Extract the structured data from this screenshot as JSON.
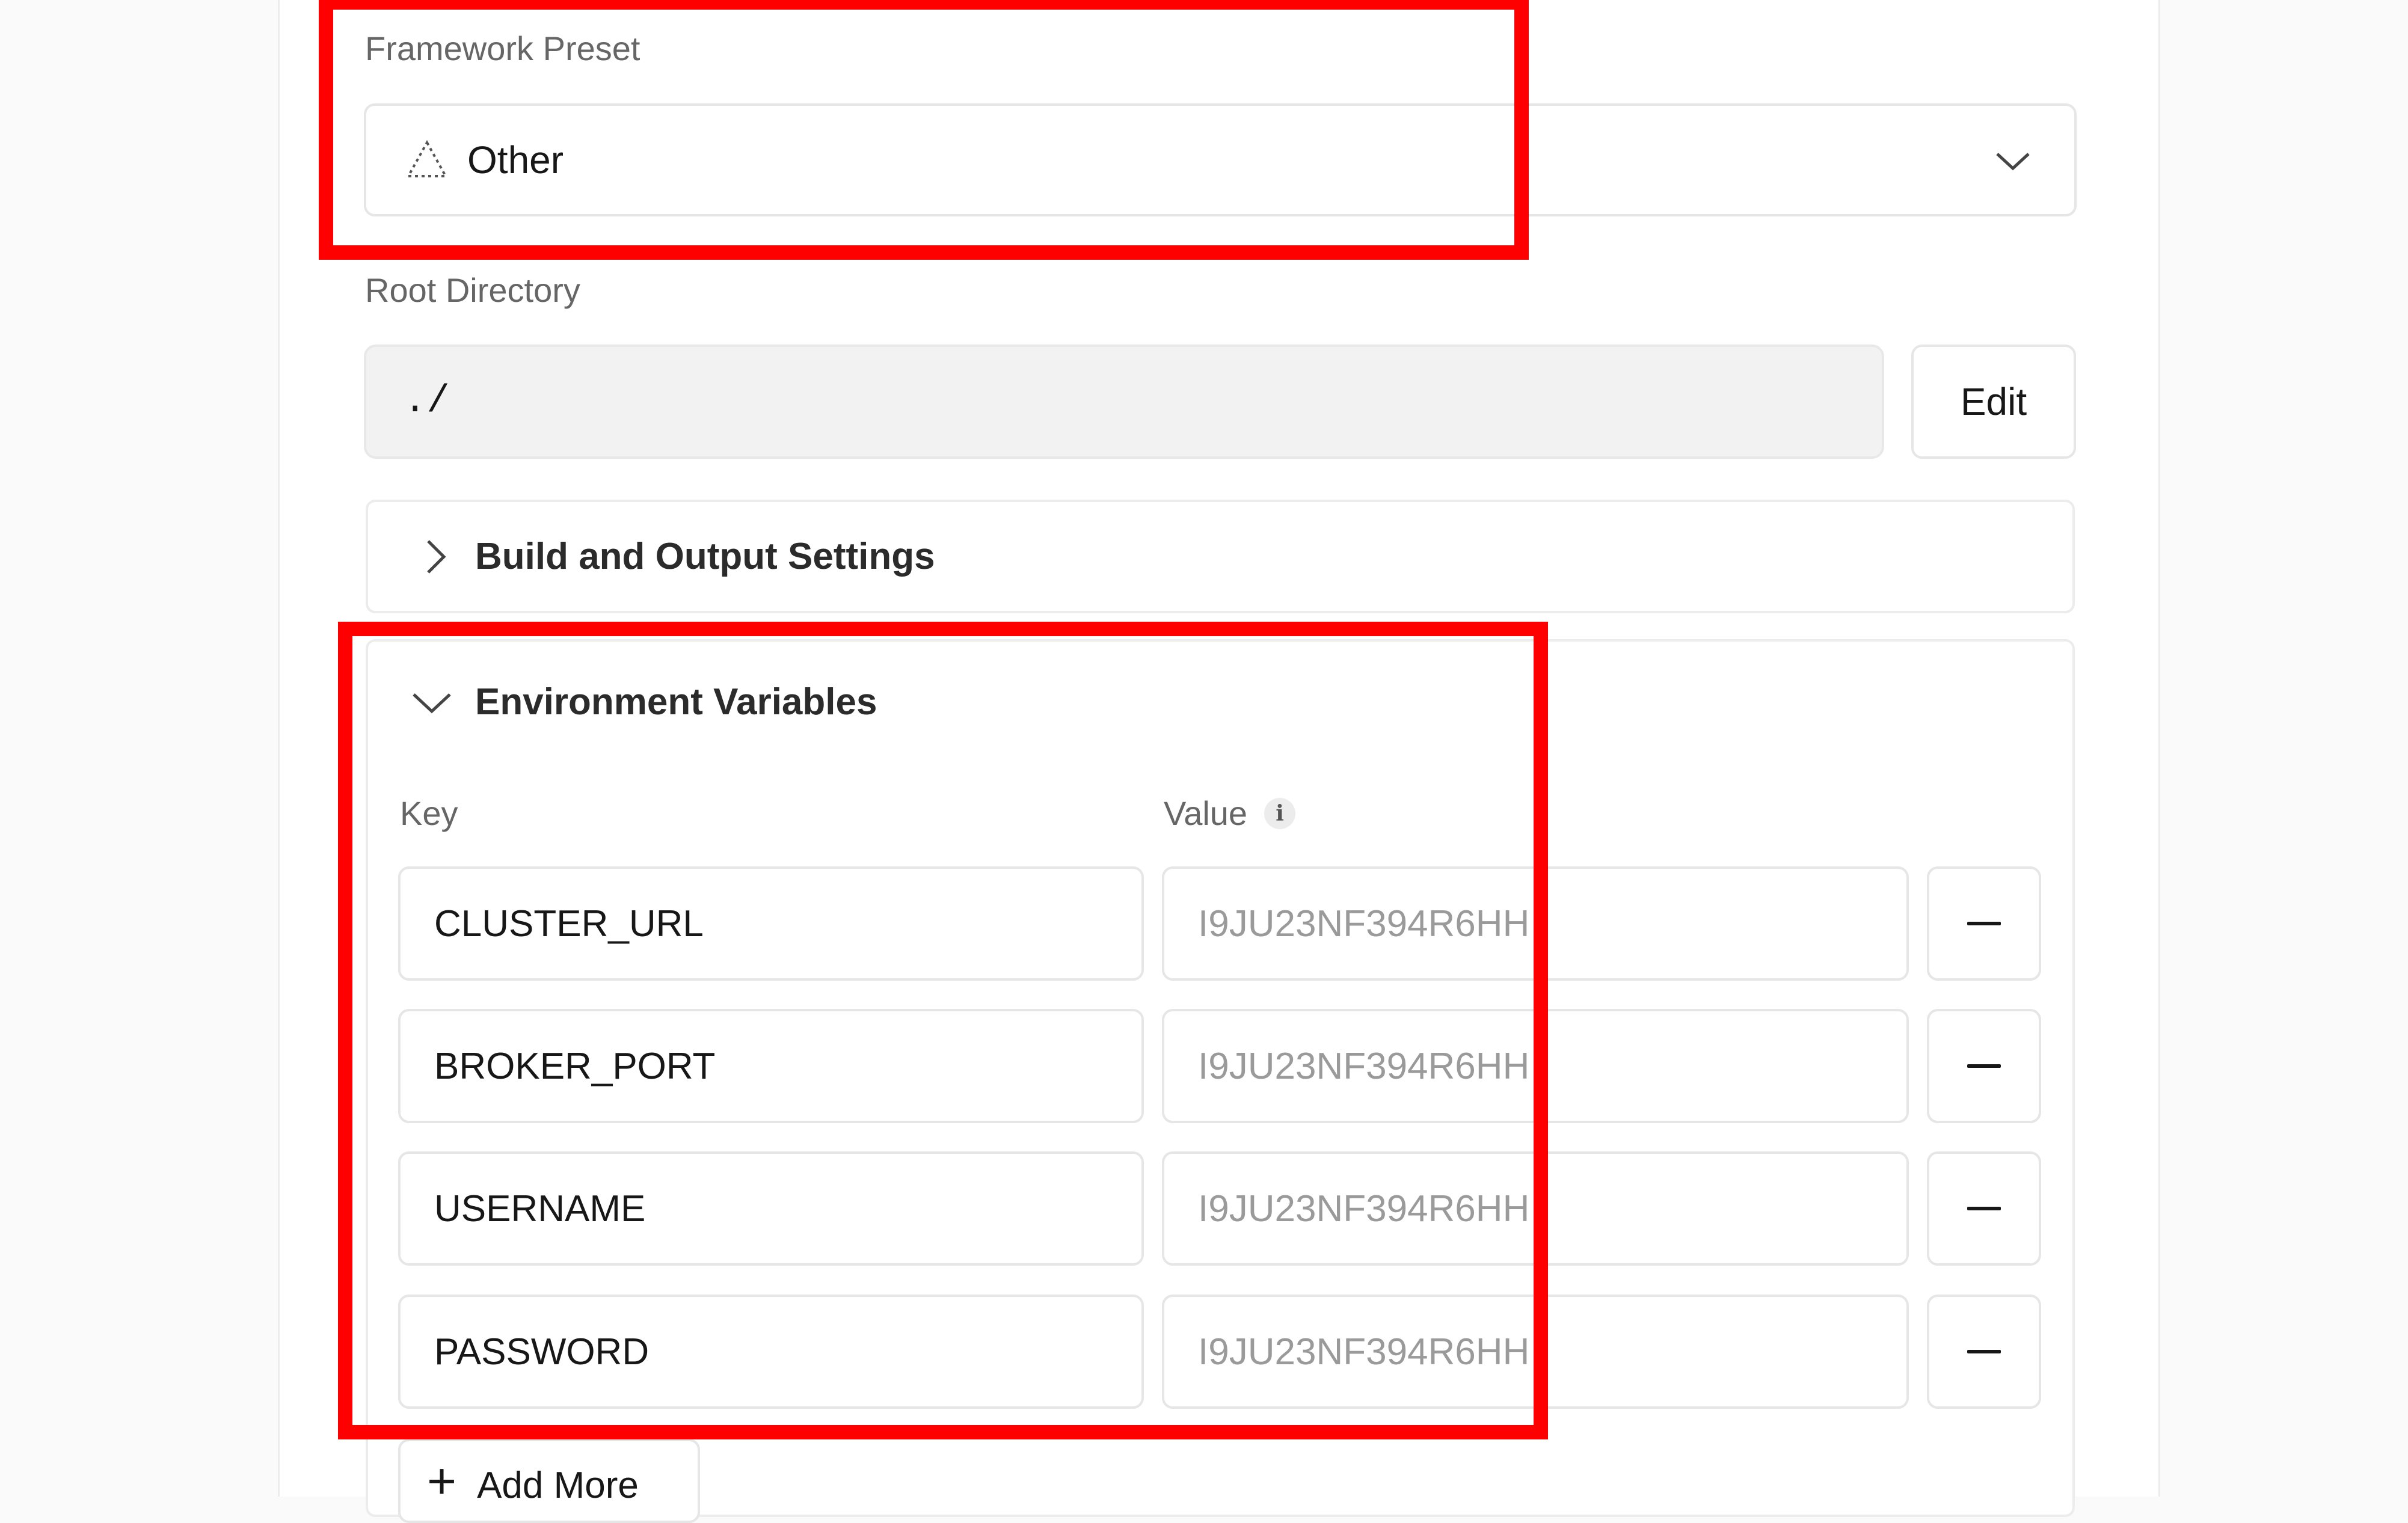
{
  "framework": {
    "label": "Framework Preset",
    "selected": "Other",
    "icon": "triangle-outline-icon",
    "dropdown_icon": "chevron-down-icon"
  },
  "root_directory": {
    "label": "Root Directory",
    "value": "./",
    "edit_label": "Edit"
  },
  "build_settings": {
    "title": "Build and Output Settings",
    "icon": "chevron-right-icon"
  },
  "env": {
    "title": "Environment Variables",
    "icon": "chevron-down-icon",
    "key_header": "Key",
    "value_header": "Value",
    "info_icon": "info-icon",
    "rows": [
      {
        "key": "CLUSTER_URL",
        "value": "I9JU23NF394R6HH"
      },
      {
        "key": "BROKER_PORT",
        "value": "I9JU23NF394R6HH"
      },
      {
        "key": "USERNAME",
        "value": "I9JU23NF394R6HH"
      },
      {
        "key": "PASSWORD",
        "value": "I9JU23NF394R6HH"
      }
    ],
    "remove_icon": "minus-icon",
    "add_more_label": "Add More"
  },
  "colors": {
    "highlight": "#ff0000",
    "text": "#171717",
    "muted": "#666666",
    "border": "#e6e6e6"
  }
}
